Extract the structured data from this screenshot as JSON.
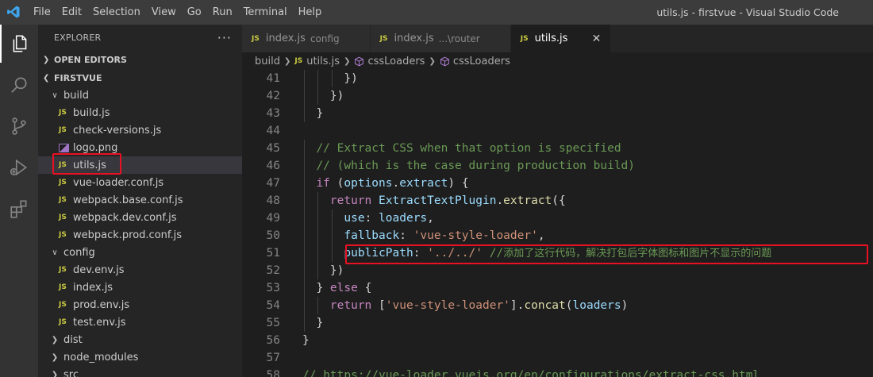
{
  "window": {
    "title": "utils.js - firstvue - Visual Studio Code",
    "menu": [
      "File",
      "Edit",
      "Selection",
      "View",
      "Go",
      "Run",
      "Terminal",
      "Help"
    ]
  },
  "activity_bar": [
    {
      "name": "explorer-icon",
      "active": true
    },
    {
      "name": "search-icon",
      "active": false
    },
    {
      "name": "source-control-icon",
      "active": false
    },
    {
      "name": "run-debug-icon",
      "active": false
    },
    {
      "name": "extensions-icon",
      "active": false
    }
  ],
  "sidebar": {
    "title": "EXPLORER",
    "more": "···",
    "open_editors": "OPEN EDITORS",
    "project": "FIRSTVUE",
    "tree": [
      {
        "label": "build",
        "type": "folder",
        "expanded": true,
        "depth": 1
      },
      {
        "label": "build.js",
        "type": "js",
        "depth": 2
      },
      {
        "label": "check-versions.js",
        "type": "js",
        "depth": 2
      },
      {
        "label": "logo.png",
        "type": "image",
        "depth": 2
      },
      {
        "label": "utils.js",
        "type": "js",
        "depth": 2,
        "selected": true
      },
      {
        "label": "vue-loader.conf.js",
        "type": "js",
        "depth": 2
      },
      {
        "label": "webpack.base.conf.js",
        "type": "js",
        "depth": 2
      },
      {
        "label": "webpack.dev.conf.js",
        "type": "js",
        "depth": 2
      },
      {
        "label": "webpack.prod.conf.js",
        "type": "js",
        "depth": 2
      },
      {
        "label": "config",
        "type": "folder",
        "expanded": true,
        "depth": 1
      },
      {
        "label": "dev.env.js",
        "type": "js",
        "depth": 2
      },
      {
        "label": "index.js",
        "type": "js",
        "depth": 2
      },
      {
        "label": "prod.env.js",
        "type": "js",
        "depth": 2
      },
      {
        "label": "test.env.js",
        "type": "js",
        "depth": 2
      },
      {
        "label": "dist",
        "type": "folder",
        "expanded": false,
        "depth": 1
      },
      {
        "label": "node_modules",
        "type": "folder",
        "expanded": false,
        "depth": 1
      },
      {
        "label": "src",
        "type": "folder",
        "expanded": false,
        "depth": 1
      }
    ]
  },
  "tabs": [
    {
      "icon": "JS",
      "label": "index.js",
      "desc": "config",
      "active": false
    },
    {
      "icon": "JS",
      "label": "index.js",
      "desc": "...\\router",
      "active": false
    },
    {
      "icon": "JS",
      "label": "utils.js",
      "desc": "",
      "active": true,
      "close": "✕"
    }
  ],
  "breadcrumb": {
    "icon": "JS",
    "items": [
      "build",
      "utils.js",
      "cssLoaders",
      "cssLoaders"
    ]
  },
  "editor": {
    "lines": [
      {
        "n": "41",
        "text": "      })"
      },
      {
        "n": "42",
        "text": "    })"
      },
      {
        "n": "43",
        "text": "  }"
      },
      {
        "n": "44",
        "text": ""
      },
      {
        "n": "45",
        "text": "  // Extract CSS when that option is specified"
      },
      {
        "n": "46",
        "text": "  // (which is the case during production build)"
      },
      {
        "n": "47",
        "text": "  if (options.extract) {"
      },
      {
        "n": "48",
        "text": "    return ExtractTextPlugin.extract({"
      },
      {
        "n": "49",
        "text": "      use: loaders,"
      },
      {
        "n": "50",
        "text": "      fallback: 'vue-style-loader',"
      },
      {
        "n": "51",
        "text": "      publicPath: '../../' //添加了这行代码，解决打包后字体图标和图片不显示的问题"
      },
      {
        "n": "52",
        "text": "    })"
      },
      {
        "n": "53",
        "text": "  } else {"
      },
      {
        "n": "54",
        "text": "    return ['vue-style-loader'].concat(loaders)"
      },
      {
        "n": "55",
        "text": "  }"
      },
      {
        "n": "56",
        "text": "}"
      },
      {
        "n": "57",
        "text": ""
      },
      {
        "n": "58",
        "text": "// https://vue-loader.vuejs.org/en/configurations/extract-css.html"
      }
    ]
  },
  "colors": {
    "annotation": "#e81123",
    "keyword": "#c586c0",
    "function": "#dcdcaa",
    "variable": "#9cdcfe",
    "string": "#ce9178",
    "comment": "#6a9955"
  }
}
